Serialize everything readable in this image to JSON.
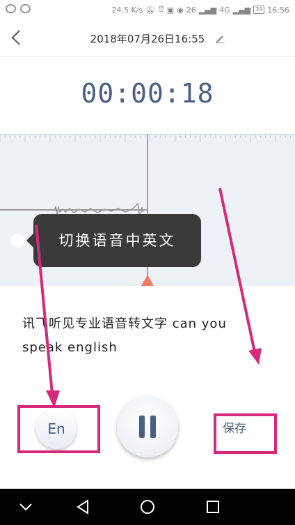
{
  "status_bar": {
    "speed": "24.5 K/s",
    "signal_26": "26",
    "signal_4g": "4G",
    "battery": "39",
    "time": "16:56"
  },
  "header": {
    "title": "2018年07月26日16:55"
  },
  "timer": "00:00:18",
  "tooltip": {
    "text": "切换语音中英文"
  },
  "transcript": {
    "text": "讯飞听见专业语音转文字 can you\nspeak english"
  },
  "controls": {
    "language_label": "En",
    "save_label": "保存"
  },
  "colors": {
    "accent": "#4a5f85",
    "cursor": "#ee7d66",
    "annotation": "#d7287a"
  }
}
